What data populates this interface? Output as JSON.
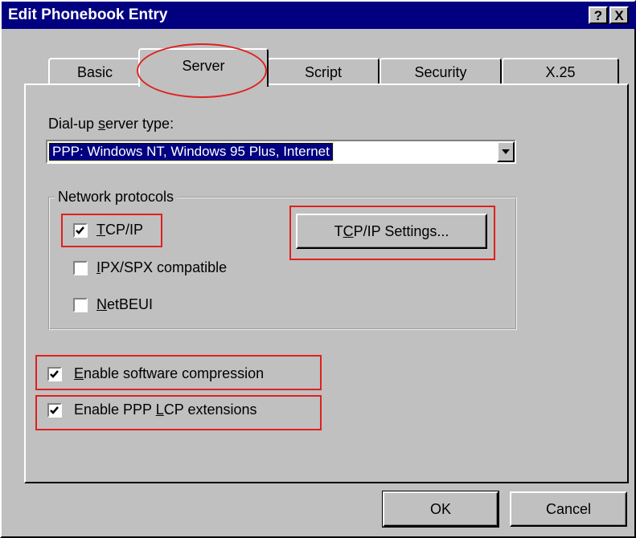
{
  "window": {
    "title": "Edit Phonebook Entry",
    "help_button": "?",
    "close_button": "X"
  },
  "tabs": [
    {
      "label": "Basic",
      "active": false
    },
    {
      "label": "Server",
      "active": true
    },
    {
      "label": "Script",
      "active": false
    },
    {
      "label": "Security",
      "active": false
    },
    {
      "label": "X.25",
      "active": false
    }
  ],
  "server_type": {
    "label": "Dial-up server type:",
    "selected_value": "PPP: Windows NT, Windows 95 Plus, Internet"
  },
  "network_protocols": {
    "legend": "Network protocols",
    "items": [
      {
        "label": "TCP/IP",
        "checked": true
      },
      {
        "label": "IPX/SPX compatible",
        "checked": false
      },
      {
        "label": "NetBEUI",
        "checked": false
      }
    ],
    "settings_button": "TCP/IP Settings..."
  },
  "options": [
    {
      "label": "Enable software compression",
      "checked": true
    },
    {
      "label": "Enable PPP LCP extensions",
      "checked": true
    }
  ],
  "footer": {
    "ok_label": "OK",
    "cancel_label": "Cancel"
  },
  "colors": {
    "titlebar": "#000080",
    "face": "#c0c0c0",
    "highlight_annotation": "#e02020"
  }
}
